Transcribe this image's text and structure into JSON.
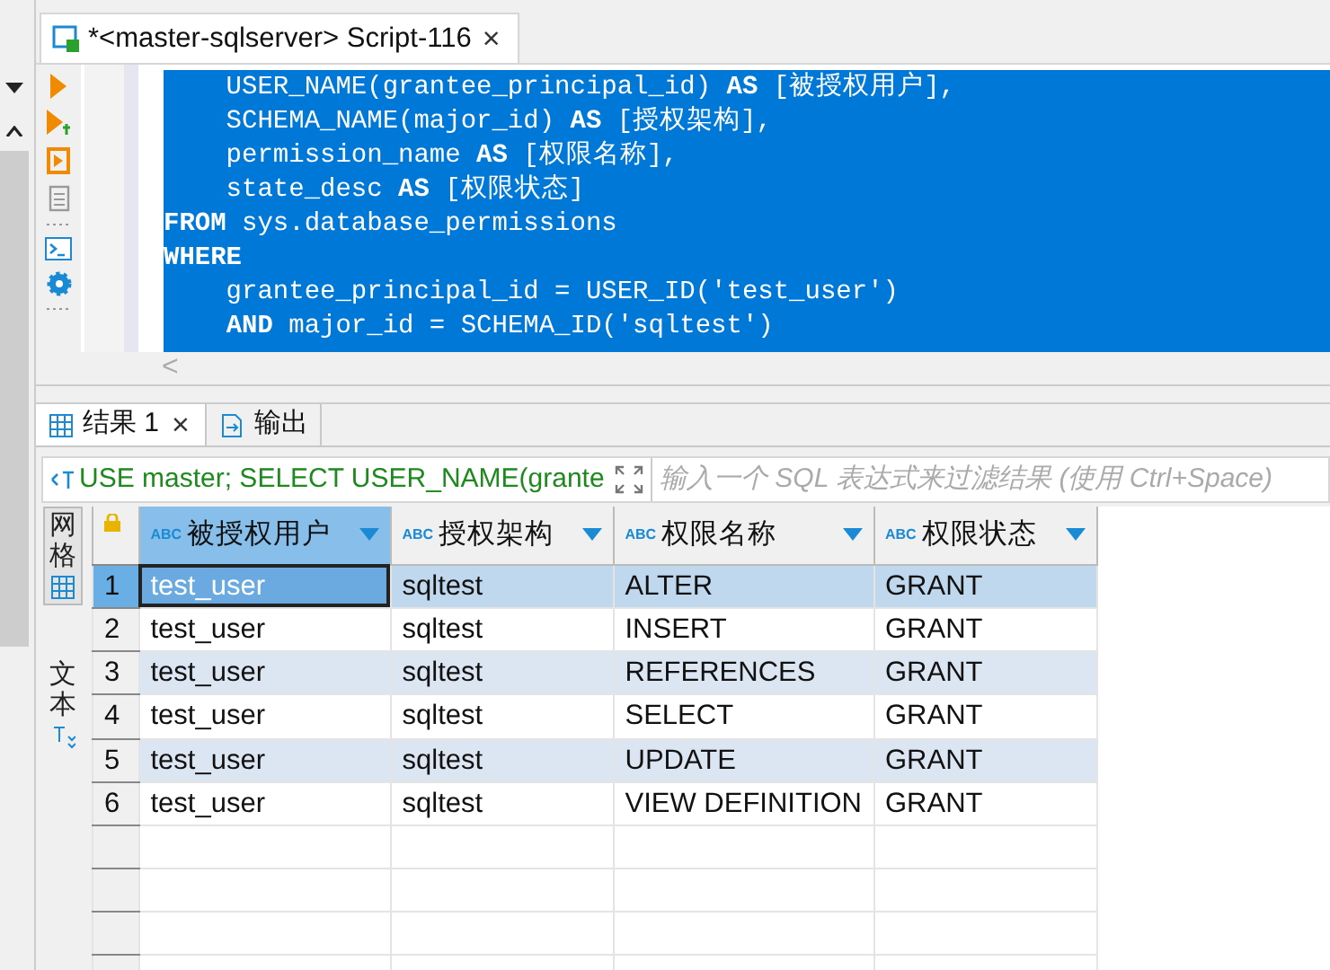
{
  "editor_tab": {
    "title": "*<master-sqlserver> Script-116",
    "close": "×"
  },
  "code_lines": [
    "    USER_NAME(grantee_principal_id) **AS** [被授权用户],",
    "    SCHEMA_NAME(major_id) **AS** [授权架构],",
    "    permission_name **AS** [权限名称],",
    "    state_desc **AS** [权限状态]",
    "**FROM** sys.database_permissions",
    "**WHERE**",
    "    grantee_principal_id = USER_ID('test_user')",
    "    **AND** major_id = SCHEMA_ID('sqltest')"
  ],
  "scroll_left": "<",
  "result_tabs": [
    {
      "label": "结果 1",
      "selected": true,
      "close": "×"
    },
    {
      "label": "输出",
      "selected": false
    }
  ],
  "filter": {
    "query": "USE master; SELECT USER_NAME(grante",
    "placeholder": "输入一个 SQL 表达式来过滤结果 (使用 Ctrl+Space)"
  },
  "view_tabs": [
    {
      "label": "网格",
      "selected": true
    },
    {
      "label": "文本",
      "selected": false
    }
  ],
  "columns": [
    {
      "type": "ABC",
      "label": "被授权用户"
    },
    {
      "type": "ABC",
      "label": "授权架构"
    },
    {
      "type": "ABC",
      "label": "权限名称"
    },
    {
      "type": "ABC",
      "label": "权限状态"
    }
  ],
  "rows": [
    {
      "number": "1",
      "selected": true,
      "cells": [
        "test_user",
        "sqltest",
        "ALTER",
        "GRANT"
      ]
    },
    {
      "number": "2",
      "selected": false,
      "cells": [
        "test_user",
        "sqltest",
        "INSERT",
        "GRANT"
      ]
    },
    {
      "number": "3",
      "selected": false,
      "cells": [
        "test_user",
        "sqltest",
        "REFERENCES",
        "GRANT"
      ]
    },
    {
      "number": "4",
      "selected": false,
      "cells": [
        "test_user",
        "sqltest",
        "SELECT",
        "GRANT"
      ]
    },
    {
      "number": "5",
      "selected": false,
      "cells": [
        "test_user",
        "sqltest",
        "UPDATE",
        "GRANT"
      ]
    },
    {
      "number": "6",
      "selected": false,
      "cells": [
        "test_user",
        "sqltest",
        "VIEW DEFINITION",
        "GRANT"
      ]
    }
  ]
}
